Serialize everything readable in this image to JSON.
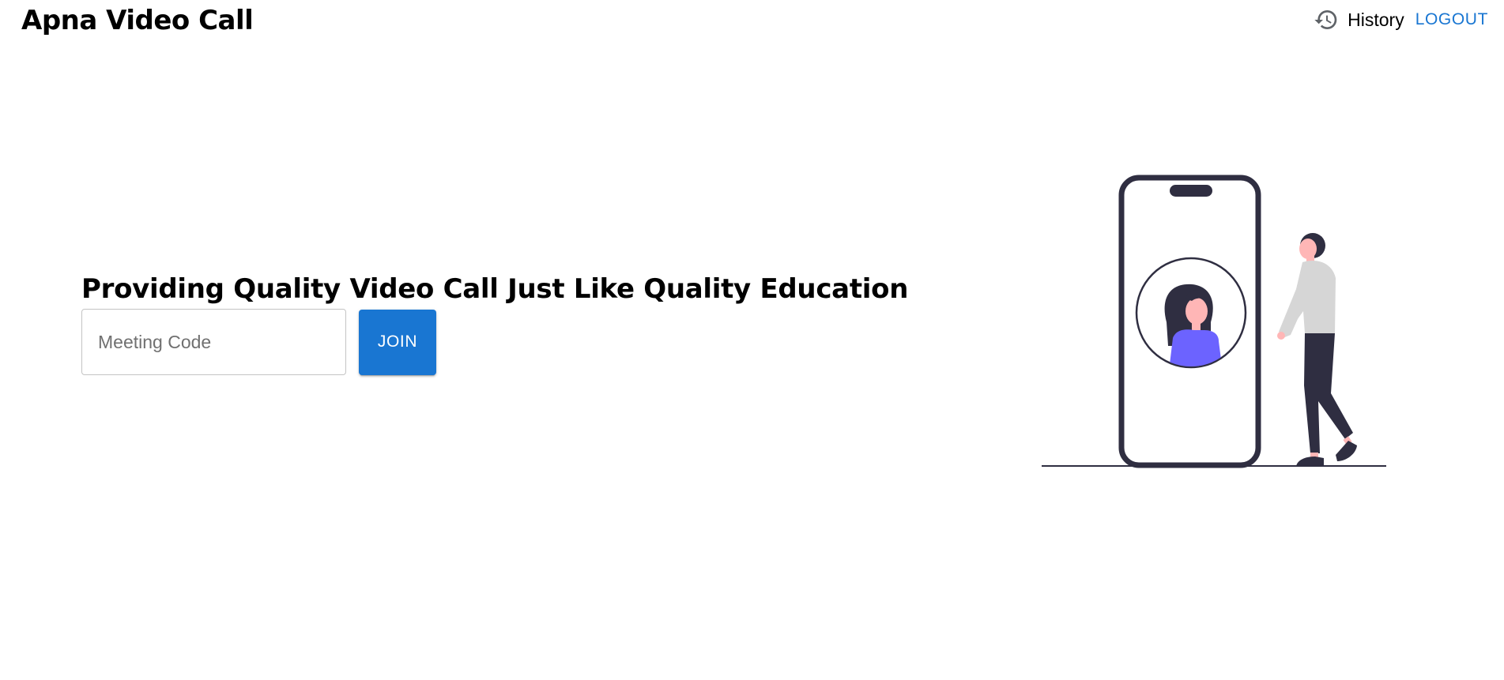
{
  "header": {
    "app_title": "Apna Video Call",
    "history_icon": "history-icon",
    "history_label": "History",
    "logout_label": "LOGOUT"
  },
  "hero": {
    "heading": "Providing Quality Video Call Just Like Quality Education",
    "meeting_code_placeholder": "Meeting Code",
    "meeting_code_value": "",
    "join_label": "JOIN"
  },
  "colors": {
    "accent": "#1976d2",
    "illustration_dark": "#2f2e41",
    "illustration_purple": "#6c63ff",
    "illustration_skin": "#ffb6b6",
    "illustration_shirt": "#d6d6d6"
  }
}
